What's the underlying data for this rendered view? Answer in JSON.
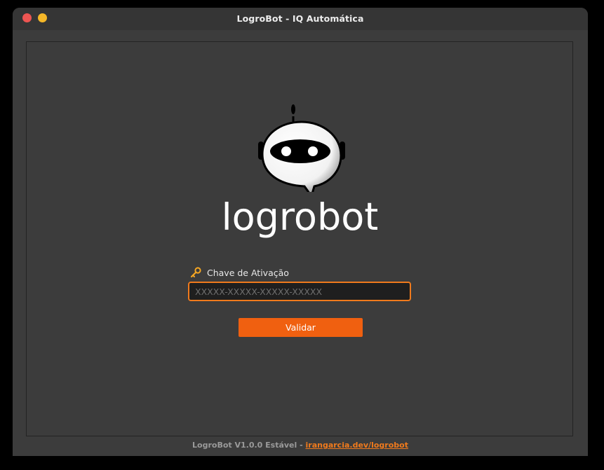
{
  "window": {
    "title": "LogroBot - IQ Automática"
  },
  "brand": {
    "wordmark": "logrobot"
  },
  "activation": {
    "label": "Chave de Ativação",
    "placeholder": "XXXXX-XXXXX-XXXXX-XXXXX",
    "value": "",
    "button_label": "Validar"
  },
  "footer": {
    "version_text": "LogroBot V1.0.0 Estável - ",
    "link_text": "irangarcia.dev/logrobot"
  },
  "colors": {
    "accent": "#f06010",
    "input_border": "#f07a1c",
    "background": "#3c3c3c",
    "close": "#ed5552",
    "minimize": "#f5b728"
  },
  "icons": {
    "key": "key-icon",
    "mascot": "robot-mascot-icon"
  }
}
